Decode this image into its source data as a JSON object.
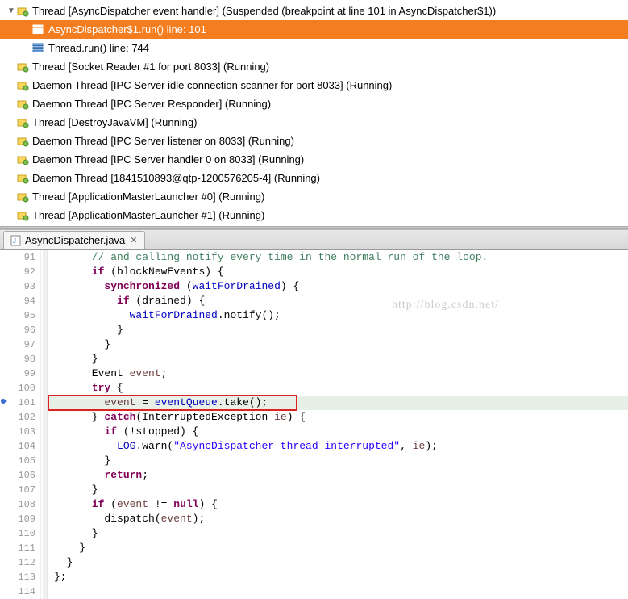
{
  "threads": {
    "root": {
      "label": "Thread [AsyncDispatcher event handler] (Suspended (breakpoint at line 101 in AsyncDispatcher$1))",
      "frames": [
        {
          "label": "AsyncDispatcher$1.run() line: 101",
          "selected": true
        },
        {
          "label": "Thread.run() line: 744",
          "selected": false
        }
      ]
    },
    "others": [
      {
        "label": "Thread [Socket Reader #1 for port 8033] (Running)",
        "daemon": false
      },
      {
        "label": "Daemon Thread [IPC Server idle connection scanner for port 8033] (Running)",
        "daemon": true
      },
      {
        "label": "Daemon Thread [IPC Server Responder] (Running)",
        "daemon": true
      },
      {
        "label": "Thread [DestroyJavaVM] (Running)",
        "daemon": false
      },
      {
        "label": "Daemon Thread [IPC Server listener on 8033] (Running)",
        "daemon": true
      },
      {
        "label": "Daemon Thread [IPC Server handler 0 on 8033] (Running)",
        "daemon": true
      },
      {
        "label": "Daemon Thread [1841510893@qtp-1200576205-4] (Running)",
        "daemon": true
      },
      {
        "label": "Thread [ApplicationMasterLauncher #0] (Running)",
        "daemon": false
      },
      {
        "label": "Thread [ApplicationMasterLauncher #1] (Running)",
        "daemon": false
      }
    ]
  },
  "editor": {
    "tab_name": "AsyncDispatcher.java",
    "breakpoint_line": 101,
    "lines": [
      {
        "n": 91,
        "code_html": "      <span class='com'>// and calling notify every time in the normal run of the loop.</span>"
      },
      {
        "n": 92,
        "code_html": "      <span class='kw'>if</span> (blockNewEvents) {"
      },
      {
        "n": 93,
        "code_html": "        <span class='kw'>synchronized</span> (<span class='field'>waitForDrained</span>) {"
      },
      {
        "n": 94,
        "code_html": "          <span class='kw'>if</span> (drained) {"
      },
      {
        "n": 95,
        "code_html": "            <span class='field'>waitForDrained</span>.notify();"
      },
      {
        "n": 96,
        "code_html": "          }"
      },
      {
        "n": 97,
        "code_html": "        }"
      },
      {
        "n": 98,
        "code_html": "      }"
      },
      {
        "n": 99,
        "code_html": "      Event <span class='var'>event</span>;"
      },
      {
        "n": 100,
        "code_html": "      <span class='kw'>try</span> {"
      },
      {
        "n": 101,
        "code_html": "        <span class='var'>event</span> = <span class='field'>eventQueue</span>.take();",
        "bp": true
      },
      {
        "n": 102,
        "code_html": "      } <span class='kw'>catch</span>(InterruptedException <span class='var'>ie</span>) {"
      },
      {
        "n": 103,
        "code_html": "        <span class='kw'>if</span> (!stopped) {"
      },
      {
        "n": 104,
        "code_html": "          <span class='field'>LOG</span>.warn(<span class='str'>\"AsyncDispatcher thread interrupted\"</span>, <span class='var'>ie</span>);"
      },
      {
        "n": 105,
        "code_html": "        }"
      },
      {
        "n": 106,
        "code_html": "        <span class='kw'>return</span>;"
      },
      {
        "n": 107,
        "code_html": "      }"
      },
      {
        "n": 108,
        "code_html": "      <span class='kw'>if</span> (<span class='var'>event</span> != <span class='kw'>null</span>) {"
      },
      {
        "n": 109,
        "code_html": "        dispatch(<span class='var'>event</span>);"
      },
      {
        "n": 110,
        "code_html": "      }"
      },
      {
        "n": 111,
        "code_html": "    }"
      },
      {
        "n": 112,
        "code_html": "  }"
      },
      {
        "n": 113,
        "code_html": "};"
      },
      {
        "n": 114,
        "code_html": ""
      }
    ]
  },
  "watermark": "http://blog.csdn.net/"
}
